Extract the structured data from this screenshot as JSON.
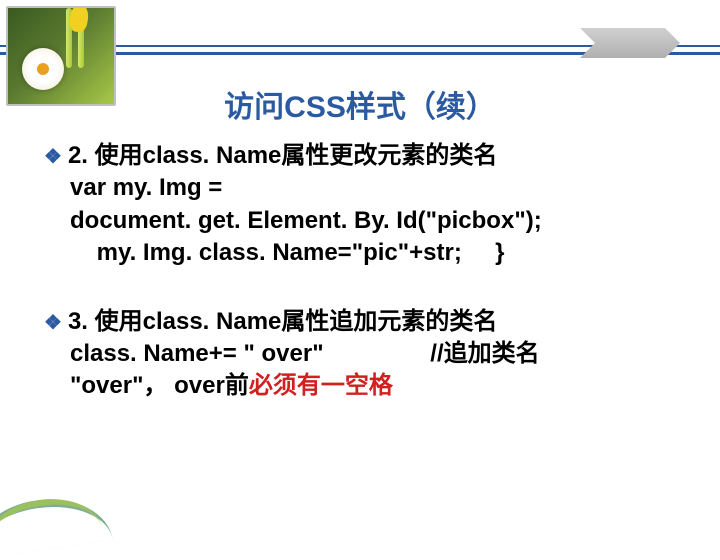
{
  "title": "访问CSS样式（续）",
  "bullets": [
    {
      "head": "2. 使用class. Name属性更改元素的类名",
      "lines": [
        "var my. Img =",
        "document. get. Element. By. Id(\"picbox\");",
        "    my. Img. class. Name=\"pic\"+str;     }"
      ]
    },
    {
      "head": "3. 使用class. Name属性追加元素的类名",
      "lines": [
        "class. Name+= \" over\"                //追加类名",
        "\"over\"， over前"
      ],
      "red_suffix": "必须有一空格"
    }
  ]
}
